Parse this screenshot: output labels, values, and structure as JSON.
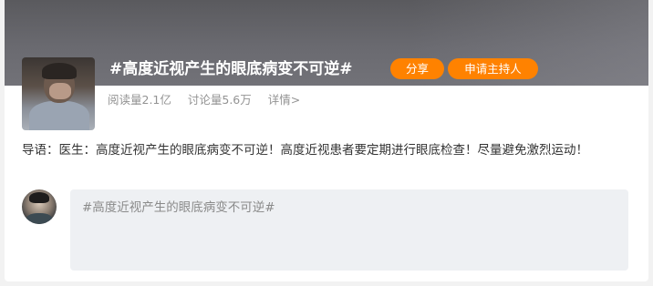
{
  "topic": {
    "title": "#高度近视产生的眼底病变不可逆#",
    "share_label": "分享",
    "apply_host_label": "申请主持人"
  },
  "stats": {
    "reads": "阅读量2.1亿",
    "discussions": "讨论量5.6万",
    "details_link": "详情>"
  },
  "intro": {
    "text": "导语：医生：高度近视产生的眼底病变不可逆！高度近视患者要定期进行眼底检查！尽量避免激烈运动！"
  },
  "comment": {
    "placeholder": "#高度近视产生的眼底病变不可逆#"
  },
  "colors": {
    "accent": "#ff8200",
    "banner": "#5e5e62",
    "input_bg": "#eef0f3",
    "muted_text": "#939393"
  }
}
